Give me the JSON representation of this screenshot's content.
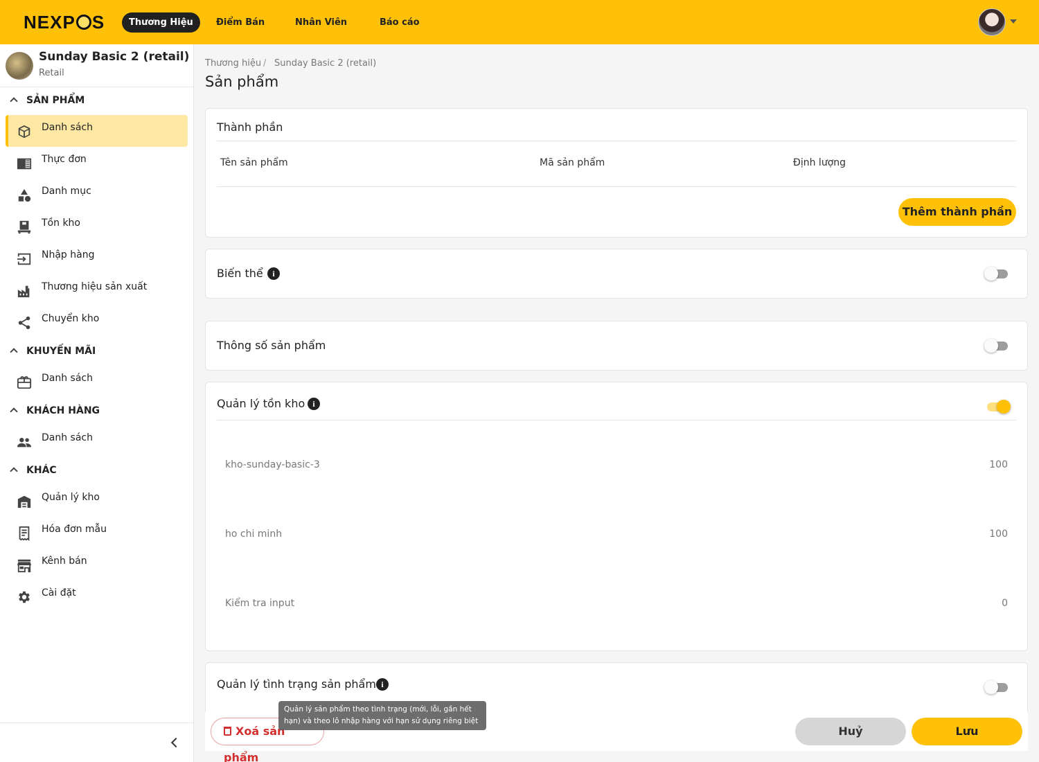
{
  "app": {
    "logo": "NEXPOS"
  },
  "topnav": {
    "items": [
      {
        "label": "Thương Hiệu",
        "active": true
      },
      {
        "label": "Điểm Bán"
      },
      {
        "label": "Nhân Viên"
      },
      {
        "label": "Báo cáo"
      }
    ]
  },
  "store": {
    "name": "Sunday Basic 2 (retail)",
    "type": "Retail"
  },
  "sidebar": {
    "sections": [
      {
        "title": "SẢN PHẨM",
        "items": [
          {
            "label": "Danh sách",
            "icon": "box-icon",
            "active": true
          },
          {
            "label": "Thực đơn",
            "icon": "menu-book-icon"
          },
          {
            "label": "Danh mục",
            "icon": "category-icon"
          },
          {
            "label": "Tồn kho",
            "icon": "inventory-icon"
          },
          {
            "label": "Nhập hàng",
            "icon": "import-icon"
          },
          {
            "label": "Thương hiệu sản xuất",
            "icon": "factory-icon"
          },
          {
            "label": "Chuyển kho",
            "icon": "share-icon"
          }
        ]
      },
      {
        "title": "KHUYẾN MÃI",
        "items": [
          {
            "label": "Danh sách",
            "icon": "gift-card-icon"
          }
        ]
      },
      {
        "title": "KHÁCH HÀNG",
        "items": [
          {
            "label": "Danh sách",
            "icon": "people-icon"
          }
        ]
      },
      {
        "title": "KHÁC",
        "items": [
          {
            "label": "Quản lý kho",
            "icon": "warehouse-icon"
          },
          {
            "label": "Hóa đơn mẫu",
            "icon": "receipt-icon"
          },
          {
            "label": "Kênh bán",
            "icon": "store-icon"
          },
          {
            "label": "Cài đặt",
            "icon": "gear-icon"
          }
        ]
      }
    ]
  },
  "breadcrumb": {
    "items": [
      "Thương hiệu",
      "Sunday Basic 2 (retail)"
    ],
    "separator": "/"
  },
  "page": {
    "title": "Sản phẩm"
  },
  "components": {
    "title": "Thành phần",
    "columns": [
      "Tên sản phẩm",
      "Mã sản phẩm",
      "Định lượng"
    ],
    "add_label": "Thêm thành phần"
  },
  "variants": {
    "title": "Biến thể",
    "enabled": false
  },
  "specs": {
    "title": "Thông số sản phẩm",
    "enabled": false
  },
  "inventory": {
    "title": "Quản lý tồn kho",
    "enabled": true,
    "warehouses": [
      {
        "name": "kho-sunday-basic-3",
        "qty": "100"
      },
      {
        "name": "ho chi minh",
        "qty": "100"
      },
      {
        "name": "Kiểm tra input",
        "qty": "0"
      }
    ]
  },
  "condition": {
    "title": "Quản lý tình trạng sản phẩm",
    "enabled": false,
    "tooltip": "Quản lý sản phẩm theo tình trạng (mới, lỗi, gần hết hạn) và theo lô nhập hàng với hạn sử dụng riêng biệt"
  },
  "footer": {
    "delete_label": "Xoá sản phẩm",
    "cancel_label": "Huỷ",
    "save_label": "Lưu"
  },
  "colors": {
    "accent": "#ffc107",
    "danger": "#d32f2f",
    "dark": "#212121"
  }
}
